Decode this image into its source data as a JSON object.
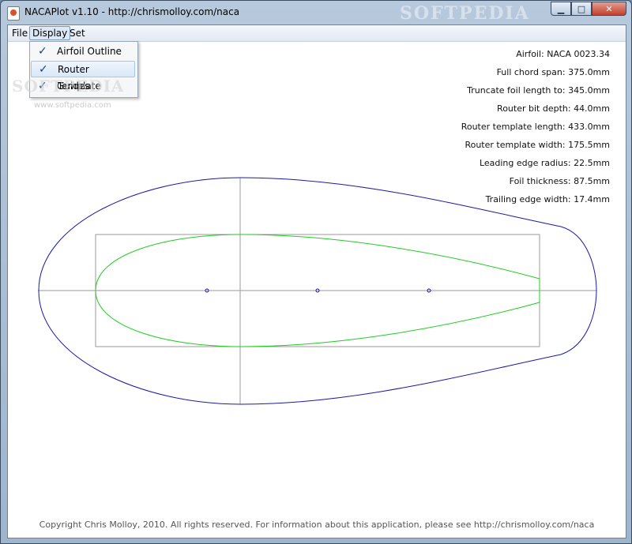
{
  "window": {
    "title": "NACAPlot v1.10 - http://chrismolloy.com/naca",
    "watermark": "SOFTPEDIA",
    "buttons": {
      "minimize": "▁",
      "maximize": "□",
      "close": "✕"
    }
  },
  "menubar": {
    "file": "File",
    "display": "Display",
    "set": "Set"
  },
  "display_menu": {
    "items": [
      {
        "label": "Airfoil Outline",
        "checked": true
      },
      {
        "label": "Router Template",
        "checked": true
      },
      {
        "label": "Guides",
        "checked": true
      }
    ],
    "check_glyph": "✓"
  },
  "softpedia_overlay": {
    "logo": "SOFTPEDIA",
    "url": "www.softpedia.com"
  },
  "info": {
    "airfoil": "Airfoil: NACA 0023.34",
    "chord": "Full chord span: 375.0mm",
    "truncate": "Truncate foil length to: 345.0mm",
    "bit_depth": "Router bit depth: 44.0mm",
    "template_length": "Router template length: 433.0mm",
    "template_width": "Router template width: 175.5mm",
    "leading_edge": "Leading edge radius: 22.5mm",
    "thickness": "Foil thickness: 87.5mm",
    "trailing_edge": "Trailing edge width: 17.4mm"
  },
  "colors": {
    "template_outline": "#1a1aa8",
    "airfoil": "#22cc22",
    "guides": "#9a9a9a"
  },
  "footer": {
    "copyright": "Copyright Chris Molloy, 2010. All rights reserved. For information about this application, please see http://chrismolloy.com/naca"
  }
}
